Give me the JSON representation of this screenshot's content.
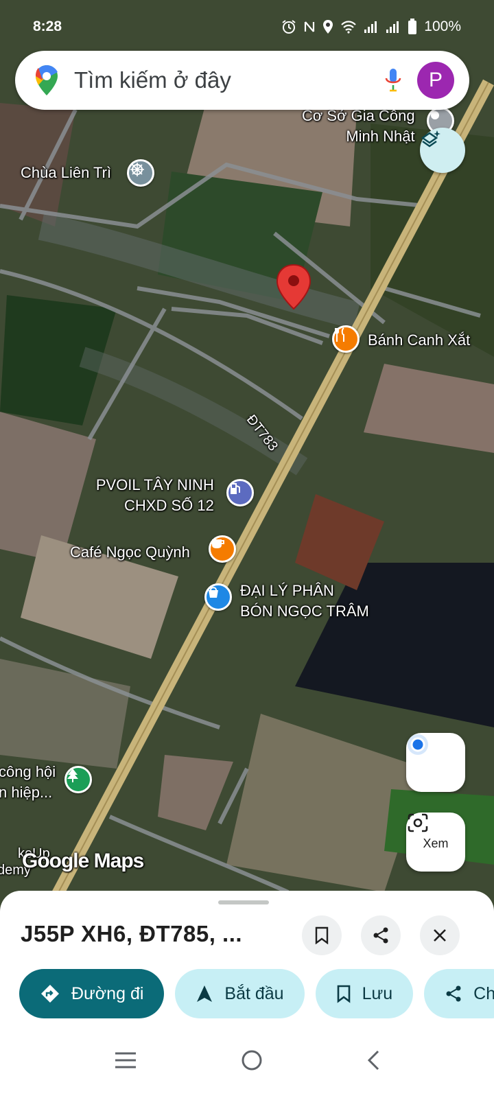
{
  "status_bar": {
    "time": "8:28",
    "battery": "100%"
  },
  "search": {
    "placeholder": "Tìm kiếm ở đây",
    "avatar_letter": "P"
  },
  "map": {
    "labels": {
      "co_so": "Cơ Sở Gia Công",
      "co_so2": "Minh Nhật",
      "chua": "Chùa Liên Trì",
      "banh_canh": "Bánh Canh Xắt",
      "road": "ĐT783",
      "pvoil1": "PVOIL TÂY NINH",
      "pvoil2": "CHXD SỐ 12",
      "cafe": "Café Ngọc Quỳnh",
      "daily1": "ĐẠI LÝ PHÂN",
      "daily2": "BÓN NGỌC TRÂM",
      "cong1": "công hội",
      "cong2": "n hiệp...",
      "edge1": "keUp",
      "edge2": "demy",
      "google_maps": "Google Maps"
    },
    "xem_label": "Xem",
    "colors": {
      "pin": "#e53935",
      "road_main": "#c8b47a",
      "cafe_poi": "#f57c00",
      "shop_poi": "#1e88e5",
      "fuel_poi": "#5c6bc0",
      "park_poi": "#1b9e57"
    }
  },
  "sheet": {
    "address": "J55P XH6, ĐT785, ...",
    "chips": [
      {
        "label": "Đường đi"
      },
      {
        "label": "Bắt đầu"
      },
      {
        "label": "Lưu"
      },
      {
        "label": "Ch"
      }
    ]
  }
}
